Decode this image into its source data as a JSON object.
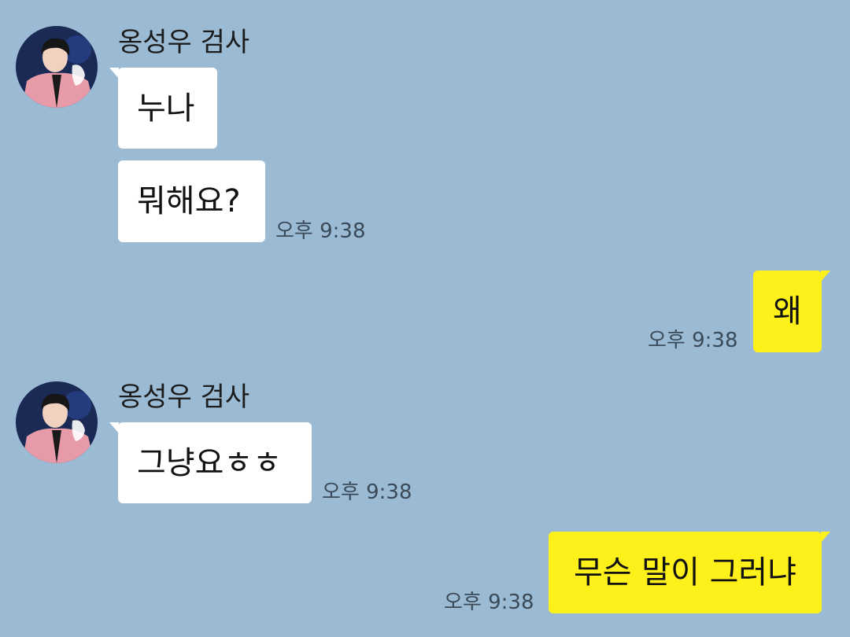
{
  "messages": [
    {
      "sender": "옹성우 검사",
      "text": "누나"
    },
    {
      "text": "뭐해요?",
      "time": "오후 9:38"
    },
    {
      "text": "왜",
      "time": "오후 9:38"
    },
    {
      "sender": "옹성우 검사",
      "text": "그냥요ㅎㅎ",
      "time": "오후 9:38"
    },
    {
      "text": "무슨 말이 그러냐",
      "time": "오후 9:38"
    }
  ],
  "colors": {
    "background": "#9bbbd4",
    "incoming_bubble": "#ffffff",
    "outgoing_bubble": "#fef01b"
  },
  "icons": {
    "avatar": "profile-photo-avatar"
  }
}
